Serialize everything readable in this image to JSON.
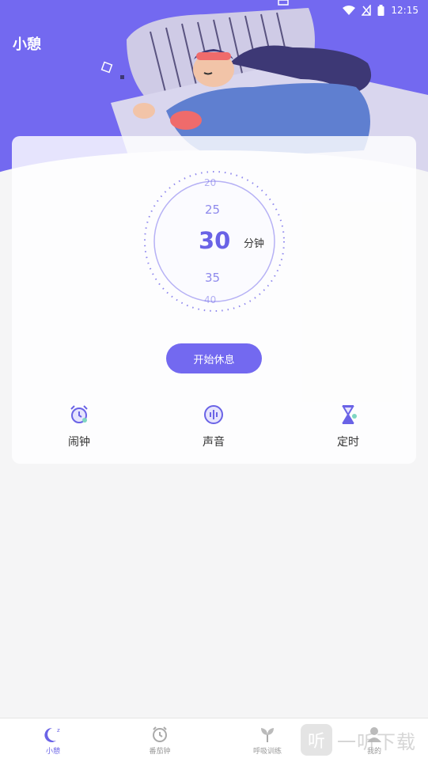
{
  "status_bar": {
    "time": "12:15"
  },
  "app_title": "小憩",
  "dial": {
    "unit": "分钟",
    "selected": "30",
    "options": [
      "20",
      "25",
      "30",
      "35",
      "40"
    ]
  },
  "start_button": "开始休息",
  "tools": [
    {
      "label": "闹钟",
      "icon": "alarm-clock-icon"
    },
    {
      "label": "声音",
      "icon": "sound-wave-icon"
    },
    {
      "label": "定时",
      "icon": "hourglass-icon"
    }
  ],
  "tabs": [
    {
      "label": "小憩",
      "icon": "moon-icon",
      "active": true
    },
    {
      "label": "番茄钟",
      "icon": "clock-icon",
      "active": false
    },
    {
      "label": "呼吸训练",
      "icon": "leaf-icon",
      "active": false
    },
    {
      "label": "我的",
      "icon": "person-icon",
      "active": false
    }
  ],
  "watermark": {
    "logo": "听",
    "text": "一听下载"
  },
  "colors": {
    "accent": "#7369f0",
    "background": "#f5f5f6"
  }
}
